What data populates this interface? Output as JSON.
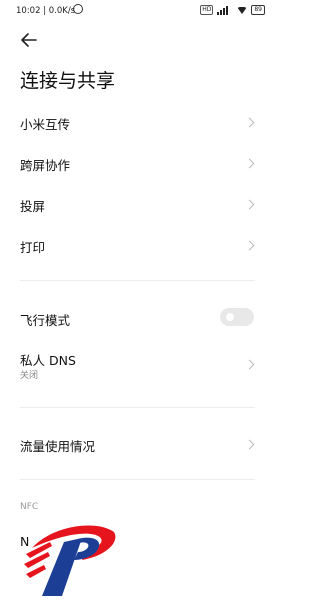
{
  "statusbar": {
    "time": "10:02",
    "speed": "0.0K/s",
    "network": "HD",
    "battery": "89"
  },
  "title": "连接与共享",
  "items": [
    {
      "label": "小米互传"
    },
    {
      "label": "跨屏协作"
    },
    {
      "label": "投屏"
    },
    {
      "label": "打印"
    }
  ],
  "airplane": {
    "label": "飞行模式",
    "enabled": false
  },
  "private_dns": {
    "label": "私人 DNS",
    "value": "关闭"
  },
  "data_usage": {
    "label": "流量使用情况"
  },
  "nfc": {
    "section": "NFC",
    "partial_label": "N"
  },
  "colors": {
    "logo_red": "#e5141d",
    "logo_blue": "#1c3f95"
  }
}
